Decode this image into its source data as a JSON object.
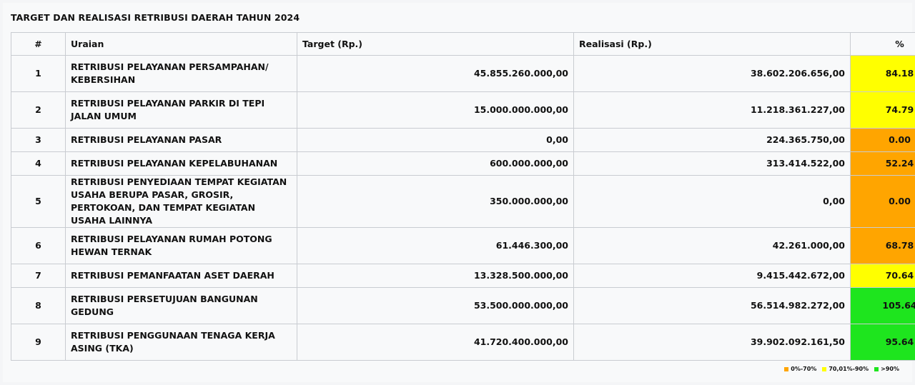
{
  "title": "TARGET DAN REALISASI RETRIBUSI DAERAH TAHUN 2024",
  "colors": {
    "low": "#ffa500",
    "mid": "#ffff00",
    "high": "#1ee51e"
  },
  "columns": {
    "no": "#",
    "uraian": "Uraian",
    "target": "Target (Rp.)",
    "realisasi": "Realisasi (Rp.)",
    "percent": "%"
  },
  "rows": [
    {
      "no": "1",
      "uraian": "RETRIBUSI PELAYANAN PERSAMPAHAN/ KEBERSIHAN",
      "target": "45.855.260.000,00",
      "realisasi": "38.602.206.656,00",
      "percent": "84.18",
      "level": "mid"
    },
    {
      "no": "2",
      "uraian": "RETRIBUSI PELAYANAN PARKIR DI TEPI JALAN UMUM",
      "target": "15.000.000.000,00",
      "realisasi": "11.218.361.227,00",
      "percent": "74.79",
      "level": "mid"
    },
    {
      "no": "3",
      "uraian": "RETRIBUSI PELAYANAN PASAR",
      "target": "0,00",
      "realisasi": "224.365.750,00",
      "percent": "0.00",
      "level": "low"
    },
    {
      "no": "4",
      "uraian": "RETRIBUSI PELAYANAN KEPELABUHANAN",
      "target": "600.000.000,00",
      "realisasi": "313.414.522,00",
      "percent": "52.24",
      "level": "low"
    },
    {
      "no": "5",
      "uraian": "RETRIBUSI PENYEDIAAN TEMPAT KEGIATAN USAHA BERUPA PASAR, GROSIR, PERTOKOAN, DAN TEMPAT KEGIATAN USAHA LAINNYA",
      "target": "350.000.000,00",
      "realisasi": "0,00",
      "percent": "0.00",
      "level": "low"
    },
    {
      "no": "6",
      "uraian": "RETRIBUSI PELAYANAN RUMAH POTONG HEWAN TERNAK",
      "target": "61.446.300,00",
      "realisasi": "42.261.000,00",
      "percent": "68.78",
      "level": "low"
    },
    {
      "no": "7",
      "uraian": "RETRIBUSI PEMANFAATAN ASET DAERAH",
      "target": "13.328.500.000,00",
      "realisasi": "9.415.442.672,00",
      "percent": "70.64",
      "level": "mid"
    },
    {
      "no": "8",
      "uraian": "RETRIBUSI PERSETUJUAN BANGUNAN GEDUNG",
      "target": "53.500.000.000,00",
      "realisasi": "56.514.982.272,00",
      "percent": "105.64",
      "level": "high"
    },
    {
      "no": "9",
      "uraian": "RETRIBUSI PENGGUNAAN TENAGA KERJA ASING (TKA)",
      "target": "41.720.400.000,00",
      "realisasi": "39.902.092.161,50",
      "percent": "95.64",
      "level": "high"
    }
  ],
  "legend": [
    {
      "label": "0%-70%",
      "level": "low"
    },
    {
      "label": "70,01%-90%",
      "level": "mid"
    },
    {
      "label": ">90%",
      "level": "high"
    }
  ]
}
